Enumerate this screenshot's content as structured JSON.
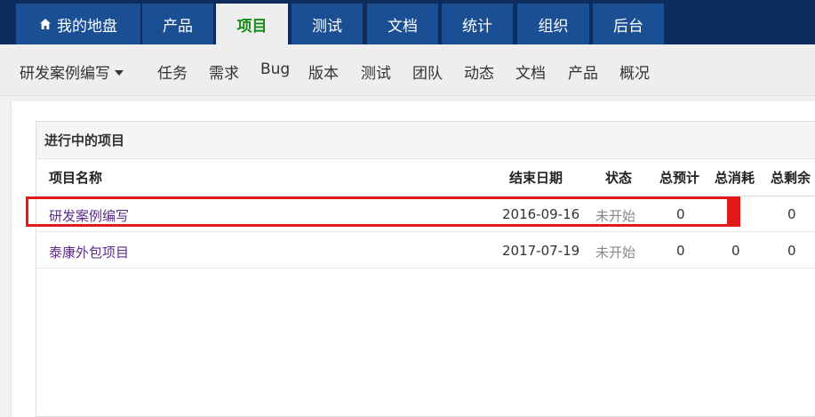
{
  "topnav": {
    "tabs": [
      {
        "label": "我的地盘",
        "icon": "home-icon"
      },
      {
        "label": "产品"
      },
      {
        "label": "项目",
        "active": true
      },
      {
        "label": "测试"
      },
      {
        "label": "文档"
      },
      {
        "label": "统计"
      },
      {
        "label": "组织"
      },
      {
        "label": "后台"
      }
    ]
  },
  "subnav": {
    "project_selector": "研发案例编写",
    "items": [
      "任务",
      "需求",
      "Bug",
      "版本",
      "测试",
      "团队",
      "动态",
      "文档",
      "产品",
      "概况"
    ]
  },
  "panel": {
    "title": "进行中的项目",
    "columns": [
      "项目名称",
      "结束日期",
      "状态",
      "总预计",
      "总消耗",
      "总剩余"
    ],
    "rows": [
      {
        "name": "研发案例编写",
        "end_date": "2016-09-16",
        "status": "未开始",
        "estimate": "0",
        "consumed": "",
        "left": "0"
      },
      {
        "name": "泰康外包项目",
        "end_date": "2017-07-19",
        "status": "未开始",
        "estimate": "0",
        "consumed": "0",
        "left": "0"
      }
    ]
  },
  "colors": {
    "topbar_bg": "#0e2d5c",
    "tab_bg": "#1b4f93",
    "active_tab_text": "#1a8a1a",
    "link": "#5b2c8a",
    "highlight": "#e0191b"
  }
}
